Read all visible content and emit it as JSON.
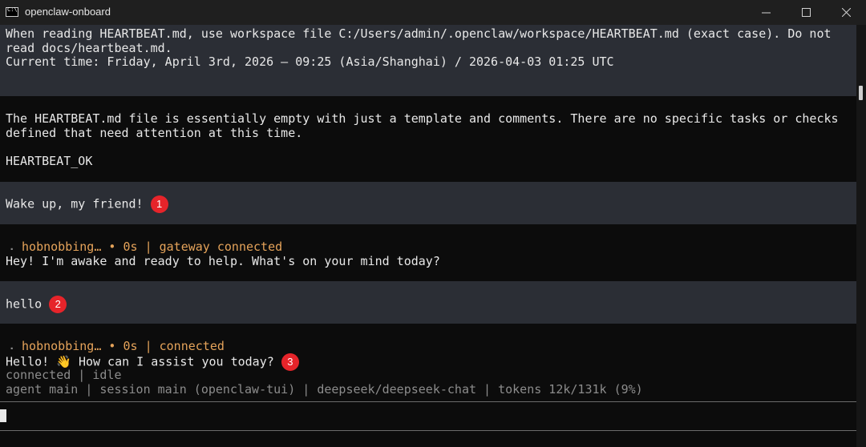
{
  "window": {
    "title": "openclaw-onboard"
  },
  "terminal": {
    "system_block": {
      "line1": "When reading HEARTBEAT.md, use workspace file C:/Users/admin/.openclaw/workspace/HEARTBEAT.md (exact case). Do not",
      "line2": "read docs/heartbeat.md.",
      "line3": "Current time: Friday, April 3rd, 2026 — 09:25 (Asia/Shanghai) / 2026-04-03 01:25 UTC"
    },
    "response1": {
      "line1": "The HEARTBEAT.md file is essentially empty with just a template and comments. There are no specific tasks or checks",
      "line2": "defined that need attention at this time.",
      "line3": "HEARTBEAT_OK"
    },
    "user1": {
      "text": "Wake up, my friend!",
      "badge": "1"
    },
    "assistant1": {
      "name": "hobnobbing…",
      "dot": "•",
      "time": "0s",
      "sep": "|",
      "status": "gateway connected",
      "text": "Hey! I'm awake and ready to help. What's on your mind today?"
    },
    "user2": {
      "text": "hello",
      "badge": "2"
    },
    "assistant2": {
      "name": "hobnobbing…",
      "dot": "•",
      "time": "0s",
      "sep": "|",
      "status": "connected",
      "text_before": "Hello!",
      "emoji": "👋",
      "text_after": "How can I assist you today?",
      "badge": "3"
    },
    "status_line1": "connected | idle",
    "status_line2": "agent main | session main (openclaw-tui) | deepseek/deepseek-chat | tokens 12k/131k (9%)"
  },
  "colors": {
    "accent_orange": "#e5a35a",
    "badge_red": "#e6242a",
    "block_gray": "#2b2e35"
  }
}
